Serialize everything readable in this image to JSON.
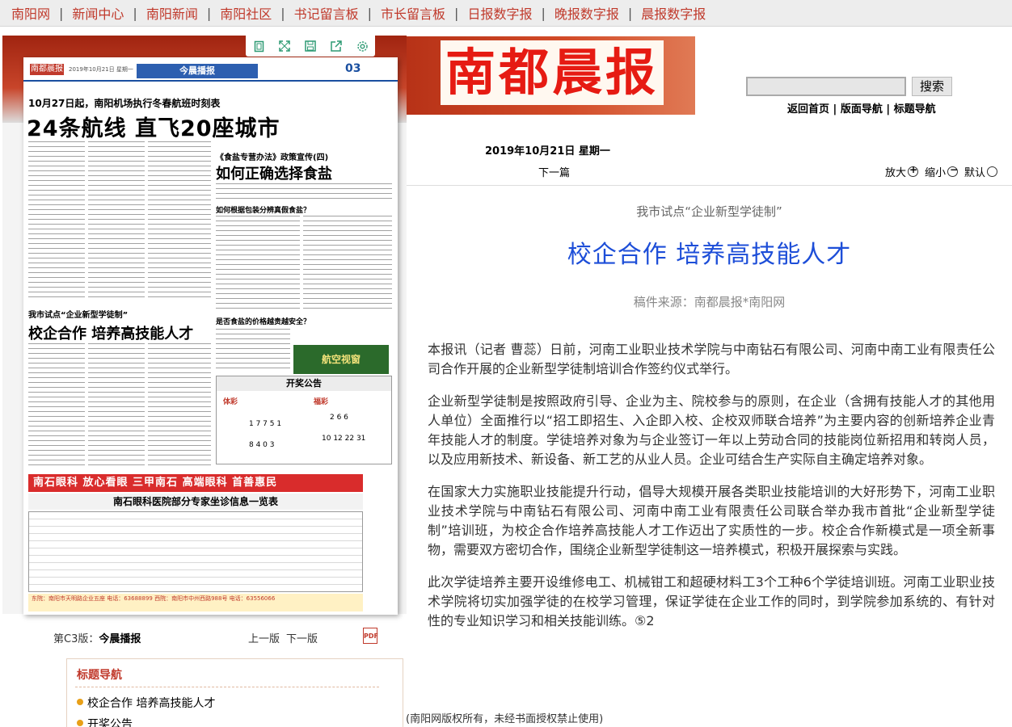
{
  "nav": {
    "items": [
      "南阳网",
      "新闻中心",
      "南阳新闻",
      "南阳社区",
      "书记留言板",
      "市长留言板",
      "日报数字报",
      "晚报数字报",
      "晨报数字报"
    ],
    "separator": "|"
  },
  "paper": {
    "page_label": "第C3版：",
    "page_name": "今晨播报",
    "prev_page": "上一版",
    "next_page": "下一版",
    "pdf_label": "PDF",
    "thumb": {
      "logo": "南都晨报",
      "date": "2019年10月21日 星期一",
      "banner": "今晨播报",
      "page_no": "03",
      "kicker": "10月27日起，南阳机场执行冬春航班时刻表",
      "headline": "24条航线 直飞20座城市",
      "salt_kicker": "《食盐专营办法》政策宣传(四)",
      "salt_headline": "如何正确选择食盐",
      "sub1": "如何根据包装分辨真假食盐？",
      "sub2": "是否食盐的价格越贵越安全？",
      "article_kicker": "我市试点“企业新型学徒制”",
      "article_headline": "校企合作 培养高技能人才",
      "stamp": "航空视窗",
      "lottery_title": "开奖公告",
      "lottery_left": "体彩",
      "lottery_right": "福彩",
      "lottery_nums1": "1 7 7 5 1",
      "lottery_nums2": "2 6 6",
      "lottery_nums3": "8 4 0 3",
      "lottery_nums4": "10 12 22 31",
      "ad_banner": "南石眼科 放心看眼 三甲南石 高端眼科 首善惠民",
      "ad_title": "南石眼科医院部分专家坐诊信息一览表",
      "ad_foot": "东院：南阳市天明路企业五座 电话：63688899 西院：南阳市中州西路988号 电话：63556066"
    }
  },
  "title_nav": {
    "heading": "标题导航",
    "items": [
      "校企合作 培养高技能人才",
      "开奖公告"
    ]
  },
  "masthead": {
    "name": "南都晨报"
  },
  "search": {
    "placeholder": "",
    "button": "搜索"
  },
  "quicklinks": {
    "home": "返回首页",
    "layout_nav": "版面导航",
    "title_nav": "标题导航",
    "sep": " | "
  },
  "article": {
    "date": "2019年10月21日 星期一",
    "next": "下一篇",
    "font_large": "放大",
    "font_small": "缩小",
    "font_default": "默认",
    "kicker": "我市试点“企业新型学徒制”",
    "title": "校企合作  培养高技能人才",
    "source": "稿件来源：南都晨报*南阳网",
    "paragraphs": [
      "本报讯（记者 曹蕊）日前，河南工业职业技术学院与中南钻石有限公司、河南中南工业有限责任公司合作开展的企业新型学徒制培训合作签约仪式举行。",
      "企业新型学徒制是按照政府引导、企业为主、院校参与的原则，在企业（含拥有技能人才的其他用人单位）全面推行以“招工即招生、入企即入校、企校双师联合培养”为主要内容的创新培养企业青年技能人才的制度。学徒培养对象为与企业签订一年以上劳动合同的技能岗位新招用和转岗人员，以及应用新技术、新设备、新工艺的从业人员。企业可结合生产实际自主确定培养对象。",
      "在国家大力实施职业技能提升行动，倡导大规模开展各类职业技能培训的大好形势下，河南工业职业技术学院与中南钻石有限公司、河南中南工业有限责任公司联合举办我市首批“企业新型学徒制”培训班，为校企合作培养高技能人才工作迈出了实质性的一步。校企合作新模式是一项全新事物，需要双方密切合作，围绕企业新型学徒制这一培养模式，积极开展探索与实践。",
      "此次学徒培养主要开设维修电工、机械钳工和超硬材料工3个工种6个学徒培训班。河南工业职业技术学院将切实加强学徒的在校学习管理，保证学徒在企业工作的同时，到学院参加系统的、有针对性的专业知识学习和相关技能训练。⑤2"
    ]
  },
  "footer": {
    "copyright": "(南阳网版权所有，未经书面授权禁止使用)"
  },
  "colors": {
    "nav_link": "#c0392b",
    "title_blue": "#1d4ed8",
    "masthead_red": "#e61b13",
    "toolbar_green": "#2d9a73"
  }
}
